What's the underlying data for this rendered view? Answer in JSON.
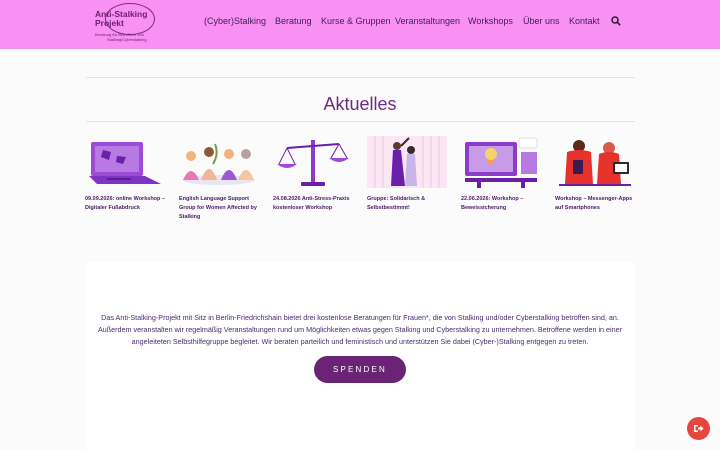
{
  "logo": {
    "line1": "Anti-Stalking",
    "line2": "Projekt",
    "tagline1": "Beratung für Betroffene von",
    "tagline2": "Stalking/Cyberstalking"
  },
  "nav": {
    "items": [
      {
        "label": "(Cyber)Stalking"
      },
      {
        "label": "Beratung"
      },
      {
        "label": "Kurse & Gruppen"
      },
      {
        "label": "Veranstaltungen"
      },
      {
        "label": "Workshops"
      },
      {
        "label": "Über uns"
      },
      {
        "label": "Kontakt"
      }
    ],
    "search_icon": "search-icon"
  },
  "news": {
    "title": "Aktuelles",
    "cards": [
      {
        "title": "09.09.2026: online Workshop – Digitaler Fußabdruck",
        "icon": "laptop-illustration"
      },
      {
        "title": "English Language Support Group for Women Affected by Stalking",
        "icon": "group-illustration"
      },
      {
        "title": "24.08.2026 Anti-Stress-Praxis kostenloser Workshop",
        "icon": "scales-illustration"
      },
      {
        "title": "Gruppe: Solidarisch & Selbstbestimmt!",
        "icon": "people-illustration"
      },
      {
        "title": "22.06.2026: Workshop – Beweissicherung",
        "icon": "workspace-illustration"
      },
      {
        "title": "Workshop – Messenger-Apps auf Smartphones",
        "icon": "smartphone-illustration"
      }
    ]
  },
  "intro": {
    "text": "Das Anti-Stalking-Projekt mit Sitz in Berlin-Friedrichshain bietet drei kostenlose Beratungen für Frauen*, die von Stalking und/oder Cyberstalking betroffen sind, an. Außerdem veranstalten wir regelmäßig Veranstaltungen rund um Möglichkeiten etwas gegen Stalking und Cyberstalking zu unternehmen. Betroffene werden in einer angeleiteten Selbsthilfegruppe begleitet. Wir beraten parteilich und feministisch und unterstützen Sie dabei (Cyber-)Stalking entgegen zu treten.",
    "donate_label": "SPENDEN"
  },
  "quick_exit": {
    "icon": "exit-icon"
  },
  "colors": {
    "header_bg": "#f990f4",
    "accent": "#6b2475",
    "heading": "#6b2d80",
    "exit_button": "#e8453c"
  }
}
